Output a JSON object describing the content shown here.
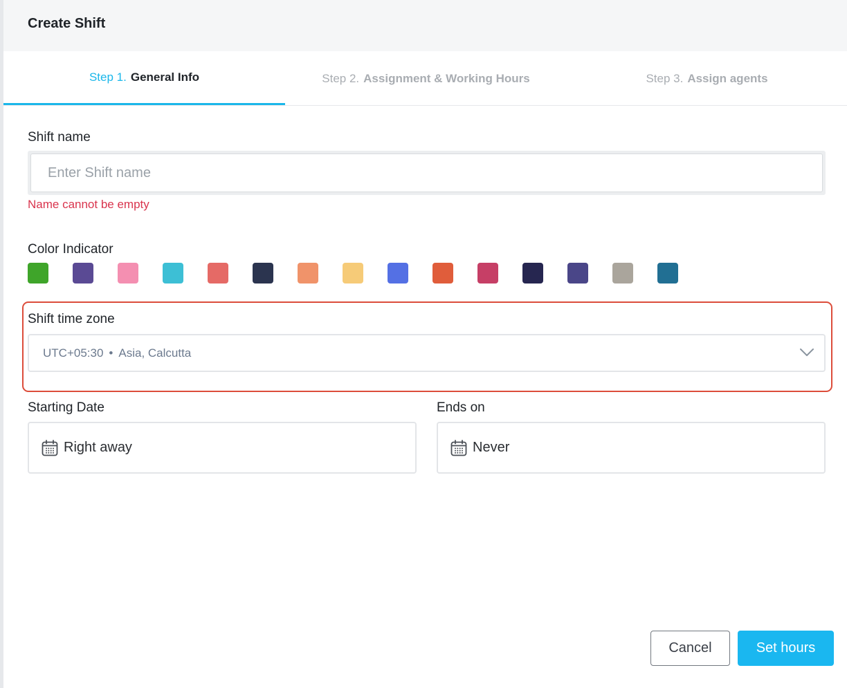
{
  "modal": {
    "title": "Create Shift"
  },
  "tabs": [
    {
      "prefix": "Step 1.",
      "name": "General Info",
      "active": true
    },
    {
      "prefix": "Step 2.",
      "name": "Assignment & Working Hours",
      "active": false
    },
    {
      "prefix": "Step 3.",
      "name": "Assign agents",
      "active": false
    }
  ],
  "shift_name": {
    "label": "Shift name",
    "value": "",
    "placeholder": "Enter Shift name",
    "error": "Name cannot be empty"
  },
  "color_indicator": {
    "label": "Color Indicator",
    "colors": [
      "#3fa52a",
      "#5a4a94",
      "#f48fb1",
      "#3dbfd5",
      "#e56a66",
      "#2b344f",
      "#f0936a",
      "#f6cb78",
      "#5470e4",
      "#e05d3b",
      "#c63f66",
      "#262650",
      "#4a4688",
      "#aaa59c",
      "#216f93"
    ]
  },
  "time_zone": {
    "label": "Shift time zone",
    "offset": "UTC+05:30",
    "separator": "•",
    "region": "Asia, Calcutta",
    "highlight_color": "#dc4c3a"
  },
  "starting_date": {
    "label": "Starting Date",
    "value": "Right away"
  },
  "ends_on": {
    "label": "Ends on",
    "value": "Never"
  },
  "buttons": {
    "cancel": "Cancel",
    "primary": "Set hours"
  },
  "theme": {
    "accent": "#1ab7ea",
    "error": "#d9344d"
  }
}
